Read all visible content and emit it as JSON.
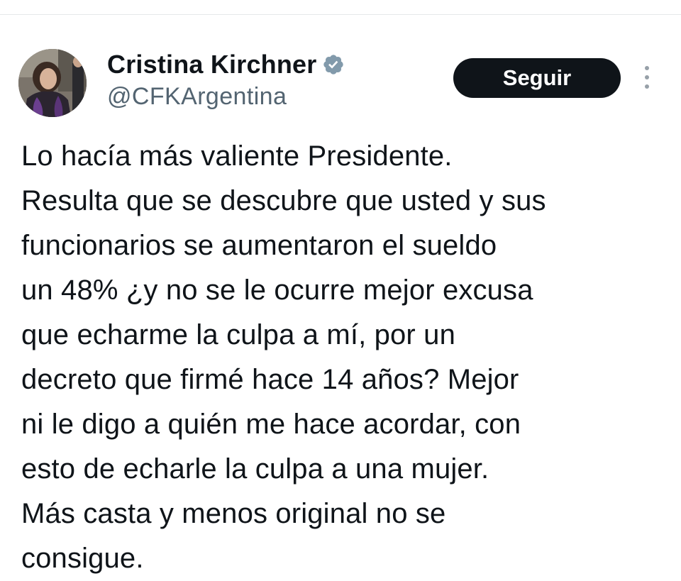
{
  "author": {
    "display_name": "Cristina Kirchner",
    "handle": "@CFKArgentina",
    "verified_icon": "verified-badge-icon",
    "verified_color": "#829aab"
  },
  "actions": {
    "follow_label": "Seguir",
    "more_icon": "more-vertical-icon"
  },
  "tweet": {
    "text": "Lo hacía más valiente Presidente.\nResulta que se descubre que usted y sus\nfuncionarios se aumentaron el sueldo\nun 48% ¿y no se le ocurre mejor excusa\nque echarme la culpa a mí, por un\ndecreto que firmé hace 14 años? Mejor\nni le digo a quién me hace acordar, con\nesto de echarle la culpa a una mujer.\nMás casta y menos original no se\nconsigue."
  },
  "colors": {
    "text": "#0f1419",
    "secondary_text": "#536471",
    "button_bg": "#0f1419",
    "button_text": "#ffffff",
    "background": "#ffffff"
  }
}
